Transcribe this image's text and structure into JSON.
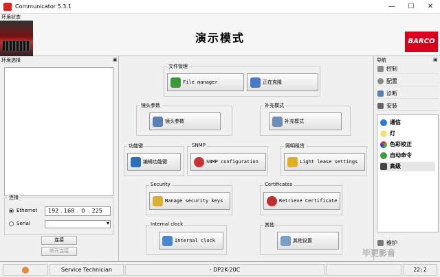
{
  "window": {
    "title": "Communicator 5.3.1",
    "minimize": "—",
    "maximize": "☐",
    "close": "✕"
  },
  "banner": {
    "env_status_label": "环境状态",
    "mode_title": "演示模式",
    "brand": "BARCO"
  },
  "left_panel": {
    "title": "环境选择",
    "pin": "▣",
    "connection": {
      "title": "连接",
      "ethernet_label": "Ethernet",
      "ip": "192 . 168 .  0  . 225",
      "serial_label": "Serial",
      "serial_value": "",
      "connect_label": "连接",
      "disconnect_label": "断开连接"
    }
  },
  "groups": {
    "file_mgmt": {
      "title": "文件管理",
      "file_manager": "File manager",
      "updating": "正在克隆"
    },
    "lens": {
      "title": "镜头参数",
      "button": "镜头参数"
    },
    "supplement": {
      "title": "补充模式",
      "button": "补充模式"
    },
    "function_keys": {
      "title": "功能键",
      "button": "编辑功能键"
    },
    "snmp": {
      "title": "SNMP",
      "button": "SNMP configuration"
    },
    "lighting": {
      "title": "照明租赁",
      "button": "Light lease settings"
    },
    "security": {
      "title": "Security",
      "button": "Manage security keys"
    },
    "certificates": {
      "title": "Certificates",
      "button": "Retrieve Certificate"
    },
    "internal_clock": {
      "title": "Internal clock",
      "button": "Internal clock"
    },
    "other": {
      "title": "其他",
      "button": "其他设置"
    }
  },
  "navigation": {
    "title": "导航",
    "items": [
      {
        "label": "控制"
      },
      {
        "label": "配置"
      },
      {
        "label": "诊断"
      },
      {
        "label": "安装"
      }
    ],
    "sub_items": [
      {
        "label": "通信"
      },
      {
        "label": "灯"
      },
      {
        "label": "色彩校正"
      },
      {
        "label": "自动命令"
      },
      {
        "label": "高级"
      }
    ],
    "maintenance": "维护"
  },
  "statusbar": {
    "role": "Service Technician",
    "model": "- DP2K-20C",
    "clock": "22:2"
  },
  "watermark": "毕更影音",
  "colors": {
    "brand_red": "#d8001d"
  }
}
